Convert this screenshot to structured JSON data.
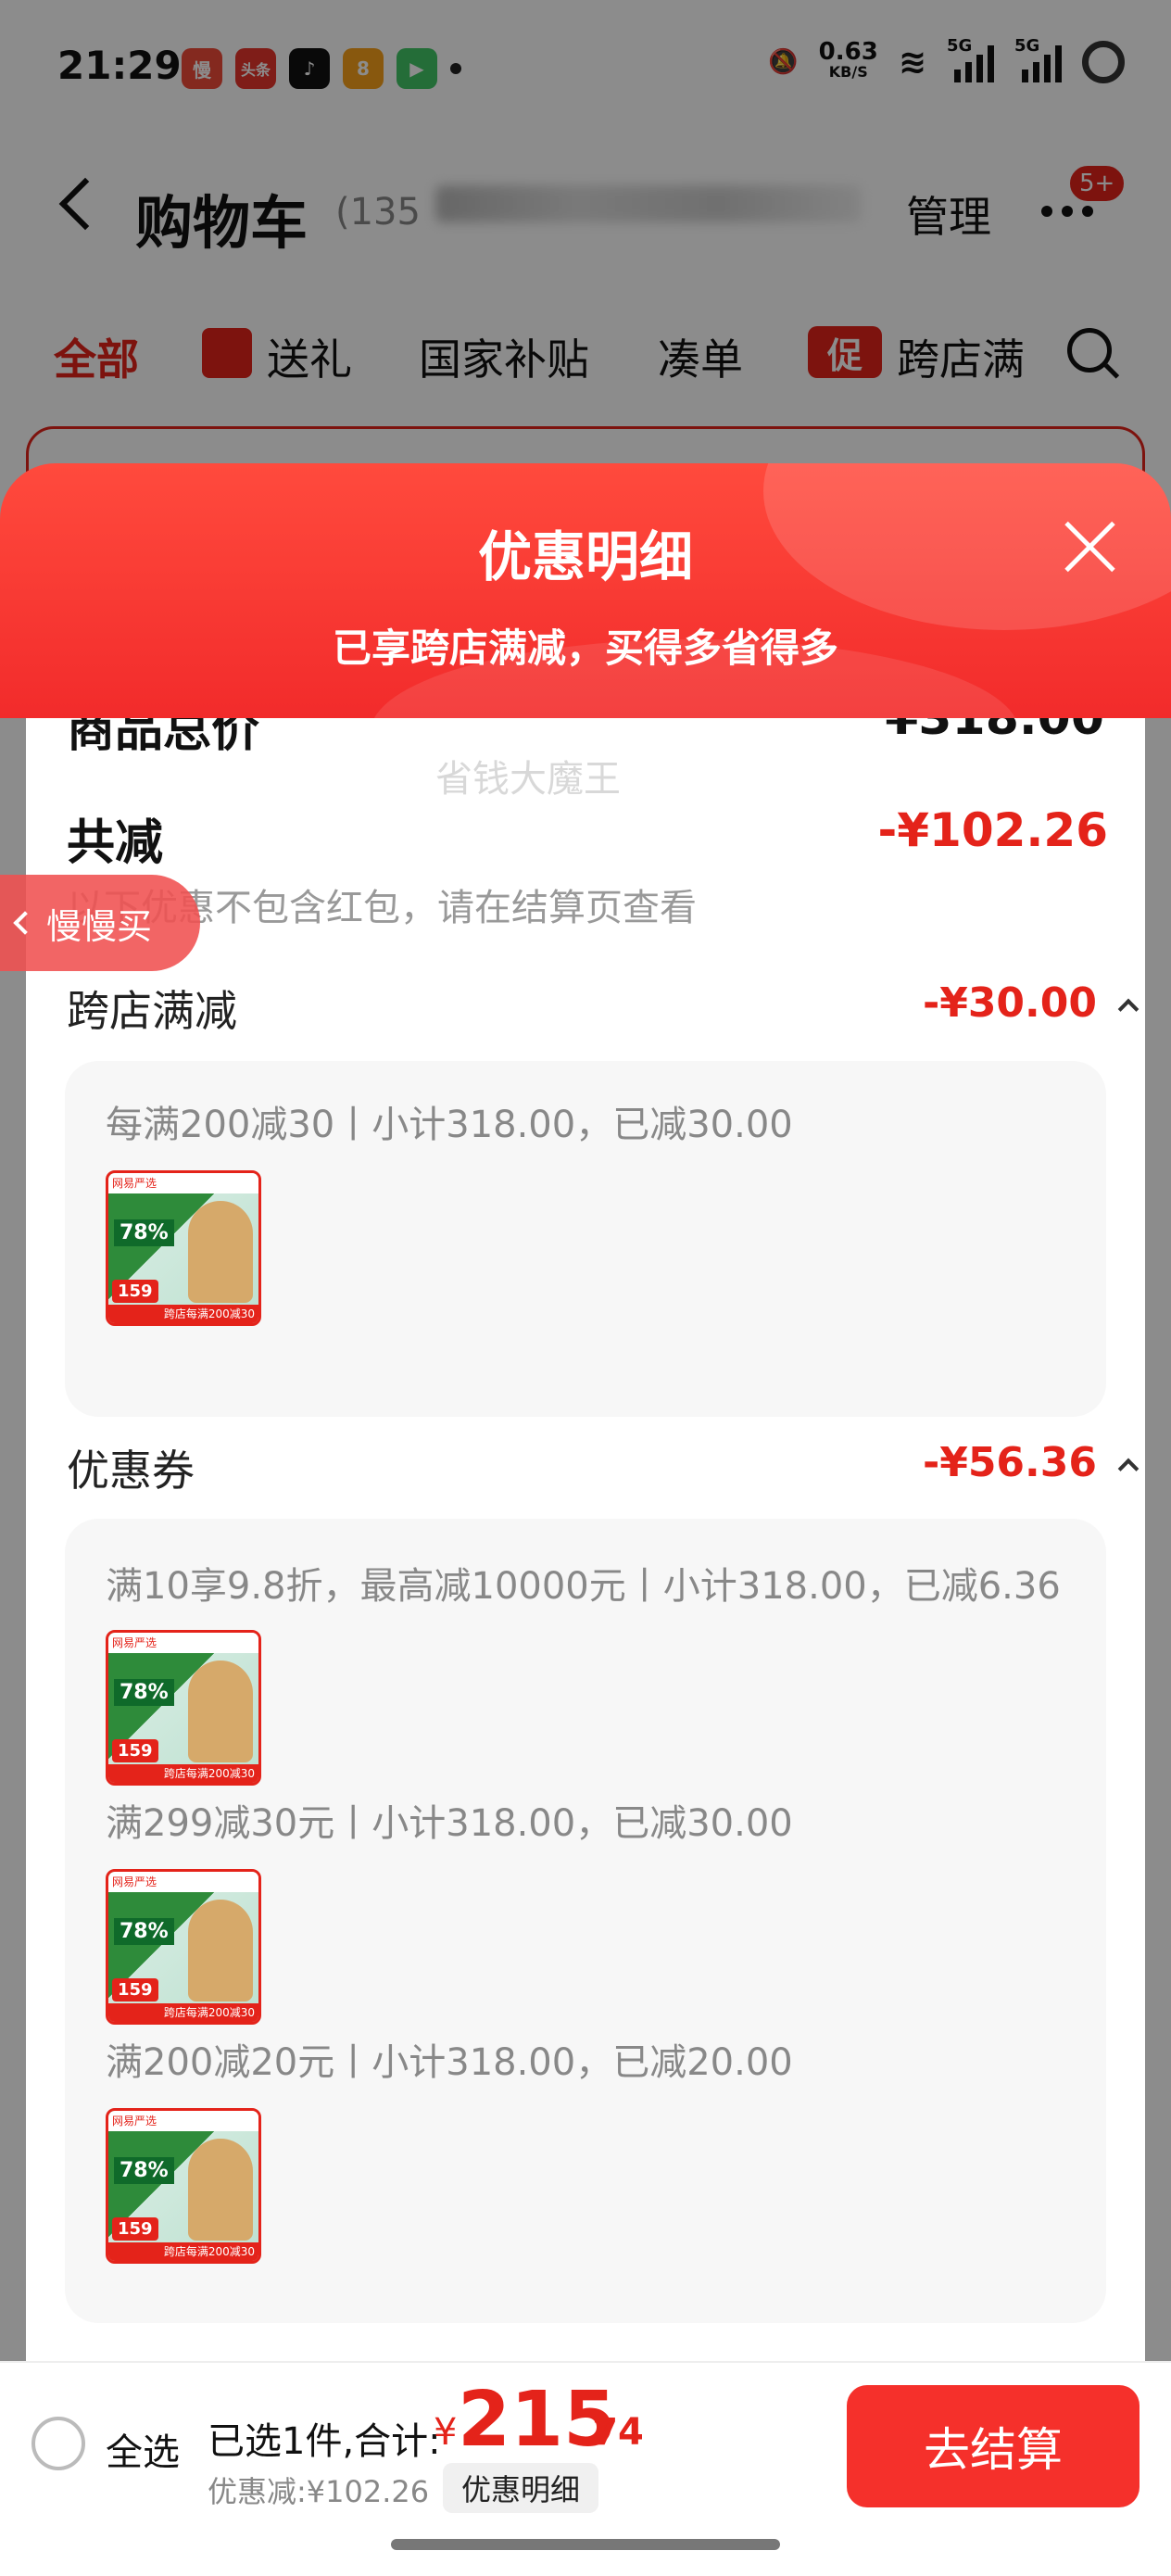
{
  "status_bar": {
    "time": "21:29",
    "apps": [
      {
        "label": "慢",
        "color": "#f04b3a"
      },
      {
        "label": "头条",
        "color": "#e8362d"
      },
      {
        "label": "♪",
        "color": "#111111"
      },
      {
        "label": "8",
        "color": "#f7a11a"
      },
      {
        "label": "▶",
        "color": "#43c667"
      }
    ],
    "net_speed": "0.63",
    "net_unit": "KB/S",
    "signal_label_1": "5G",
    "signal_label_2": "5G"
  },
  "header": {
    "title": "购物车",
    "count": "(135",
    "manage": "管理",
    "badge": "5+"
  },
  "tabs": [
    {
      "label": "全部",
      "active": true
    },
    {
      "label": "送礼"
    },
    {
      "label": "国家补贴"
    },
    {
      "label": "凑单"
    },
    {
      "label": "跨店满"
    }
  ],
  "tab_promo_label": "促",
  "sheet": {
    "title": "优惠明细",
    "subtitle": "已享跨店满减，买得多省得多",
    "partial_row_label": "商品总价",
    "partial_row_value": "¥318.00",
    "total_reduce_label": "共减",
    "total_reduce_value": "-¥102.26",
    "note": "以下优惠不包含红包，请在结算页查看",
    "sections": [
      {
        "title": "跨店满减",
        "value": "-¥30.00",
        "rules": [
          {
            "text": "每满200减30丨小计318.00，已减30.00"
          }
        ]
      },
      {
        "title": "优惠券",
        "value": "-¥56.36",
        "rules": [
          {
            "text": "满10享9.8折，最高减10000元丨小计318.00，已减6.36"
          },
          {
            "text": "满299减30元丨小计318.00，已减30.00"
          },
          {
            "text": "满200减20元丨小计318.00，已减20.00"
          }
        ]
      }
    ],
    "watermark": "省钱大魔王",
    "product_thumb": {
      "top_text": "网易严选",
      "percent": "78%",
      "price": "159",
      "footer": "跨店每满200减30"
    }
  },
  "side_tab": {
    "label": "慢慢买"
  },
  "checkout": {
    "select_all": "全选",
    "selected_info": "已选1件,合计:",
    "currency": "¥",
    "amount_int": "215",
    "amount_dec": ".74",
    "discount": "优惠减:¥102.26",
    "detail_chip": "优惠明细",
    "pay_button": "去结算"
  }
}
